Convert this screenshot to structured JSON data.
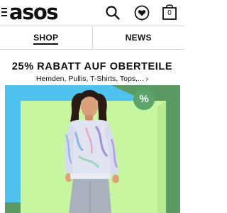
{
  "header": {
    "logo_text": "asos",
    "bag_count": "0",
    "icons": [
      "menu-icon",
      "search-icon",
      "heart-icon",
      "bag-icon"
    ]
  },
  "nav": {
    "tabs": [
      {
        "label": "SHOP",
        "active": true
      },
      {
        "label": "NEWS",
        "active": false
      }
    ]
  },
  "promo": {
    "title": "25% RABATT AUF OBERTEILE",
    "subtitle": "Hemden, Pullis, T-Shirts, Tops,... ›"
  },
  "banner": {
    "badge_text": "%",
    "colors": {
      "frame_blue": "#4fc3ee",
      "frame_green": "#5a9b64",
      "inner_green": "#c8f5a0",
      "badge": "#5ba56b"
    }
  }
}
